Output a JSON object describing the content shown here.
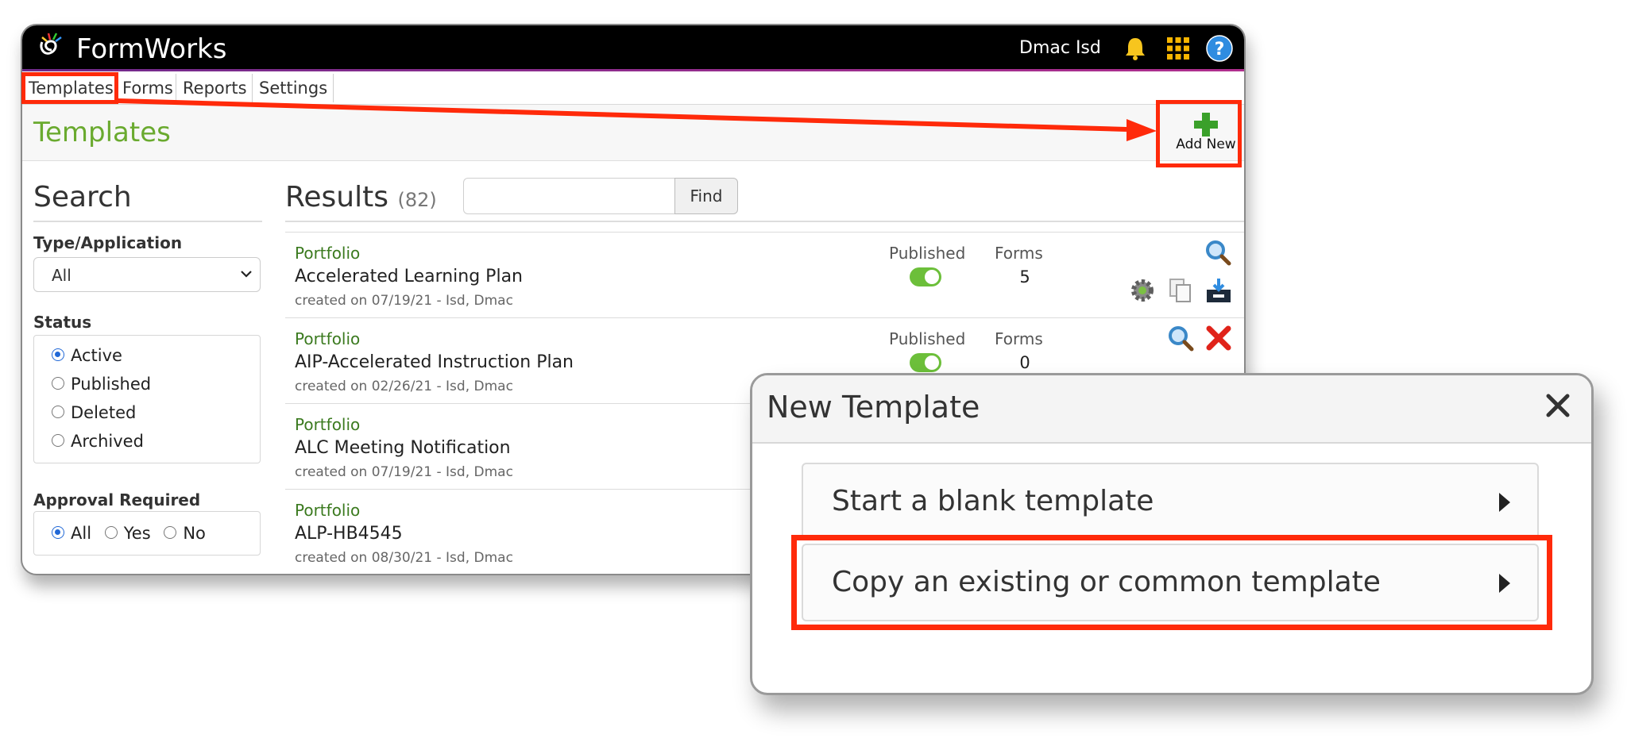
{
  "app": {
    "title": "FormWorks",
    "user": "Dmac Isd"
  },
  "nav": {
    "tabs": [
      "Templates",
      "Forms",
      "Reports",
      "Settings"
    ]
  },
  "page": {
    "title": "Templates",
    "add_new_label": "Add New"
  },
  "search": {
    "heading": "Search",
    "type_label": "Type/Application",
    "type_value": "All",
    "status_label": "Status",
    "status_options": [
      "Active",
      "Published",
      "Deleted",
      "Archived"
    ],
    "status_selected": "Active",
    "approval_label": "Approval Required",
    "approval_options": [
      "All",
      "Yes",
      "No"
    ],
    "approval_selected": "All"
  },
  "results": {
    "heading": "Results",
    "count": "(82)",
    "find_label": "Find",
    "find_value": "",
    "columns": {
      "published": "Published",
      "forms": "Forms"
    },
    "rows": [
      {
        "type": "Portfolio",
        "name": "Accelerated Learning Plan",
        "created": "created on 07/19/21 - Isd, Dmac",
        "published": true,
        "forms": "5"
      },
      {
        "type": "Portfolio",
        "name": "AIP-Accelerated Instruction Plan",
        "created": "created on 02/26/21 - Isd, Dmac",
        "published": true,
        "forms": "0"
      },
      {
        "type": "Portfolio",
        "name": "ALC Meeting Notification",
        "created": "created on 07/19/21 - Isd, Dmac"
      },
      {
        "type": "Portfolio",
        "name": "ALP-HB4545",
        "created": "created on 08/30/21 - Isd, Dmac"
      }
    ]
  },
  "modal": {
    "title": "New Template",
    "options": [
      "Start a blank template",
      "Copy an existing or common template"
    ]
  },
  "colors": {
    "accent_green": "#6aaa2f",
    "annotation_red": "#ff2a0a",
    "topbar": "#000000"
  },
  "icons": [
    "logo-icon",
    "bell-icon",
    "apps-grid-icon",
    "help-icon",
    "plus-icon",
    "search-icon",
    "gear-icon",
    "copy-icon",
    "export-icon",
    "delete-icon",
    "close-icon",
    "chevron-right-icon"
  ]
}
